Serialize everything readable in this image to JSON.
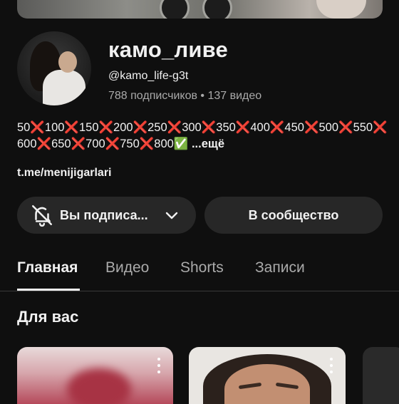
{
  "channel": {
    "name": "камо_ливе",
    "handle": "@kamo_life-g3t",
    "meta": "788 подписчиков • 137 видео",
    "description": "50❌100❌150❌200❌250❌300❌350❌400❌450❌500❌550❌600❌650❌700❌750❌800✅",
    "more_label": "...ещё",
    "link": "t.me/menijigarlari"
  },
  "buttons": {
    "subscribed_label": "Вы подписа...",
    "community_label": "В сообщество"
  },
  "tabs": [
    {
      "label": "Главная",
      "active": true
    },
    {
      "label": "Видео",
      "active": false
    },
    {
      "label": "Shorts",
      "active": false
    },
    {
      "label": "Записи",
      "active": false
    }
  ],
  "section": {
    "title": "Для вас"
  },
  "icons": {
    "bell": "bell-off-icon",
    "chevron": "chevron-down-icon",
    "more": "more-vert-icon"
  },
  "colors": {
    "background": "#0f0f0f",
    "button_bg": "#272727",
    "text": "#f1f1f1",
    "secondary_text": "#aaaaaa"
  }
}
